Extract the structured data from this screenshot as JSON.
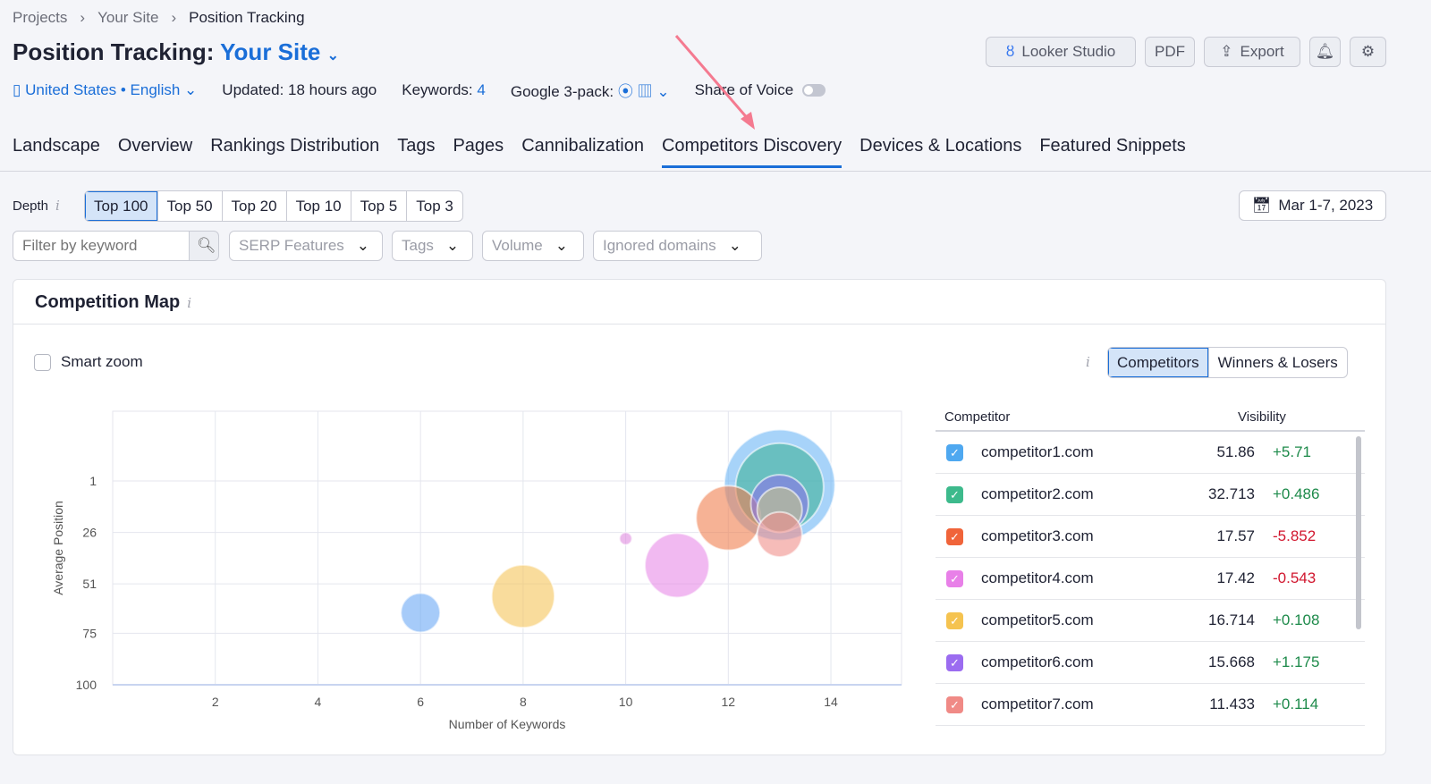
{
  "breadcrumb": [
    "Projects",
    "Your Site",
    "Position Tracking"
  ],
  "header": {
    "title": "Position Tracking:",
    "site": "Your Site",
    "locale": "United States • English",
    "updated": "Updated: 18 hours ago",
    "keywords_label": "Keywords:",
    "keywords_value": "4",
    "google_3pack": "Google 3-pack:",
    "share_of_voice": "Share of Voice",
    "share_of_voice_on": false
  },
  "toolbar": {
    "looker": "Looker Studio",
    "pdf": "PDF",
    "export": "Export"
  },
  "tabs": [
    "Landscape",
    "Overview",
    "Rankings Distribution",
    "Tags",
    "Pages",
    "Cannibalization",
    "Competitors Discovery",
    "Devices & Locations",
    "Featured Snippets"
  ],
  "active_tab": "Competitors Discovery",
  "depth": {
    "label": "Depth",
    "options": [
      "Top 100",
      "Top 50",
      "Top 20",
      "Top 10",
      "Top 5",
      "Top 3"
    ],
    "selected": "Top 100"
  },
  "date": "Mar 1-7, 2023",
  "filters": {
    "keyword_placeholder": "Filter by keyword",
    "serp": "SERP Features",
    "tags": "Tags",
    "volume": "Volume",
    "ignored": "Ignored domains"
  },
  "card": {
    "title": "Competition Map",
    "smart_zoom": "Smart zoom",
    "view_options": [
      "Competitors",
      "Winners & Losers"
    ],
    "view_selected": "Competitors"
  },
  "table": {
    "headers": [
      "Competitor",
      "Visibility"
    ],
    "rows": [
      {
        "domain": "competitor1.com",
        "visibility": "51.86",
        "change": "+5.71",
        "color": "#4fa8f0"
      },
      {
        "domain": "competitor2.com",
        "visibility": "32.713",
        "change": "+0.486",
        "color": "#3dba8c"
      },
      {
        "domain": "competitor3.com",
        "visibility": "17.57",
        "change": "-5.852",
        "color": "#f0643a"
      },
      {
        "domain": "competitor4.com",
        "visibility": "17.42",
        "change": "-0.543",
        "color": "#e880e8"
      },
      {
        "domain": "competitor5.com",
        "visibility": "16.714",
        "change": "+0.108",
        "color": "#f5c350"
      },
      {
        "domain": "competitor6.com",
        "visibility": "15.668",
        "change": "+1.175",
        "color": "#9b6cf0"
      },
      {
        "domain": "competitor7.com",
        "visibility": "11.433",
        "change": "+0.114",
        "color": "#f08a86"
      }
    ]
  },
  "chart_data": {
    "type": "scatter",
    "xlabel": "Number of Keywords",
    "ylabel": "Average Position",
    "xticks": [
      2,
      4,
      6,
      8,
      10,
      12,
      14
    ],
    "yticks": [
      1,
      26,
      51,
      75,
      100
    ],
    "xlim": [
      0,
      15.4
    ],
    "ylim": [
      100,
      -8
    ],
    "y_inverted": true,
    "grid": true,
    "points": [
      {
        "x": 13,
        "y": 3,
        "size": 51.86,
        "color": "#6cb6f5"
      },
      {
        "x": 13,
        "y": 4,
        "size": 32.7,
        "color": "#3fb39a"
      },
      {
        "x": 12,
        "y": 19,
        "size": 17.57,
        "color": "#f07f4f"
      },
      {
        "x": 11,
        "y": 42,
        "size": 17.42,
        "color": "#e88be8"
      },
      {
        "x": 8,
        "y": 57,
        "size": 16.7,
        "color": "#f5c45a"
      },
      {
        "x": 13,
        "y": 12,
        "size": 14,
        "color": "#8c73e8"
      },
      {
        "x": 13,
        "y": 15,
        "size": 8.5,
        "color": "#c8c48a"
      },
      {
        "x": 13,
        "y": 27,
        "size": 8.5,
        "color": "#f08f8a"
      },
      {
        "x": 10,
        "y": 29,
        "size": 0.66,
        "color": "#df8be0"
      },
      {
        "x": 6,
        "y": 65,
        "size": 6.5,
        "color": "#6aa8f5"
      }
    ]
  }
}
